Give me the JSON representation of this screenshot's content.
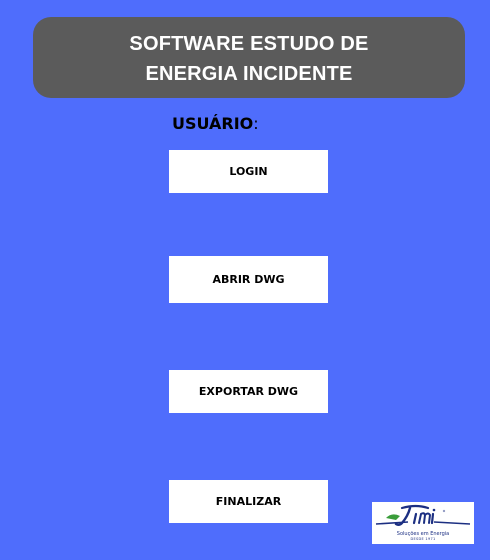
{
  "header": {
    "title_line1": "SOFTWARE ESTUDO DE",
    "title_line2": "ENERGIA INCIDENTE"
  },
  "user": {
    "label": "USUÁRIO",
    "separator": ":"
  },
  "menu": {
    "login": "LOGIN",
    "abrir_dwg": "ABRIR DWG",
    "exportar_dwg": "EXPORTAR DWG",
    "finalizar": "FINALIZAR"
  },
  "logo": {
    "wordmark": "Jimi",
    "tagline": "Soluções em Energia",
    "since": "DESDE 1971"
  },
  "colors": {
    "background": "#4f6dfc",
    "banner": "#5b5b5b",
    "button": "#ffffff",
    "logo_blue": "#1c2f82",
    "logo_green": "#3a9d3a"
  }
}
